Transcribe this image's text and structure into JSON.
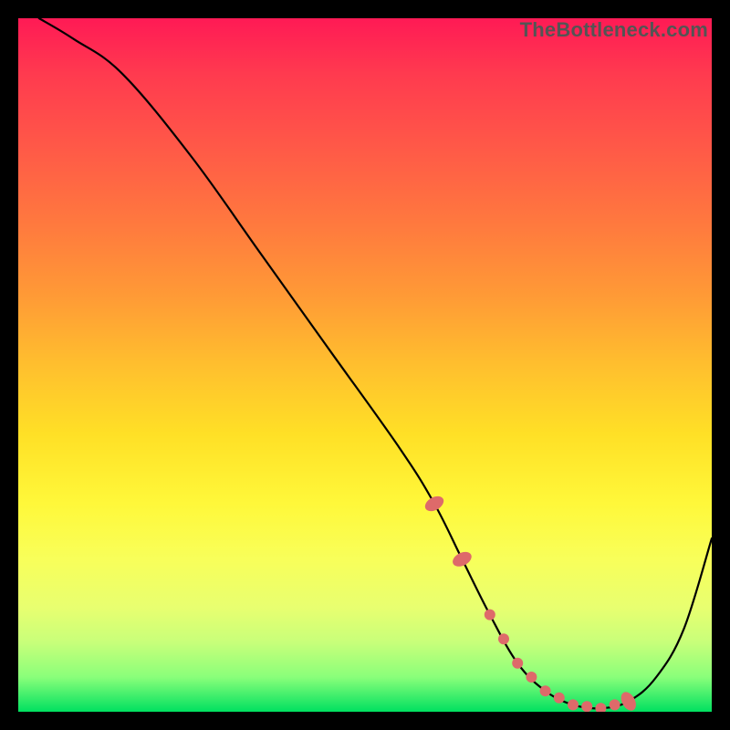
{
  "watermark": "TheBottleneck.com",
  "chart_data": {
    "type": "line",
    "title": "",
    "xlabel": "",
    "ylabel": "",
    "xlim": [
      0,
      100
    ],
    "ylim": [
      0,
      100
    ],
    "grid": false,
    "legend": false,
    "series": [
      {
        "name": "curve",
        "x": [
          3,
          8,
          15,
          25,
          35,
          45,
          55,
          60,
          64,
          68,
          72,
          76,
          80,
          84,
          88,
          92,
          96,
          100
        ],
        "y": [
          100,
          97,
          92,
          80,
          66,
          52,
          38,
          30,
          22,
          14,
          7,
          3,
          1,
          0.5,
          1.5,
          5,
          12,
          25
        ]
      }
    ],
    "markers": {
      "oval_markers_x": [
        60,
        64,
        88
      ],
      "dot_markers_x": [
        68,
        70,
        72,
        74,
        76,
        78,
        80,
        82,
        84,
        86
      ],
      "markers_color": "#de6a6a"
    },
    "background_gradient": {
      "top": "#ff1a55",
      "bottom": "#00e060"
    }
  }
}
